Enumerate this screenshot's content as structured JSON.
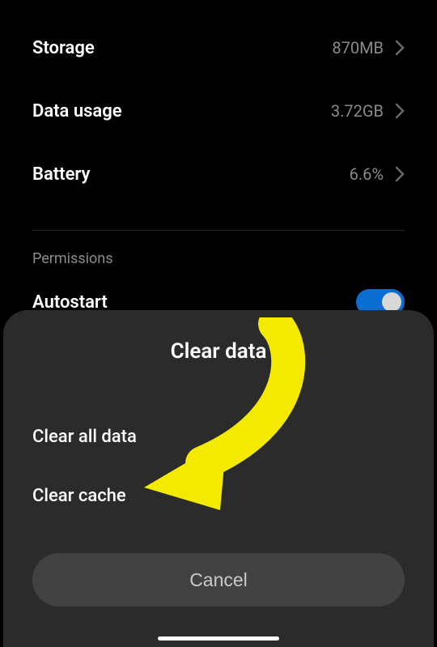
{
  "settings": {
    "rows": [
      {
        "label": "Storage",
        "value": "870MB"
      },
      {
        "label": "Data usage",
        "value": "3.72GB"
      },
      {
        "label": "Battery",
        "value": "6.6%"
      }
    ],
    "sectionHeader": "Permissions",
    "autostart": {
      "label": "Autostart",
      "enabled": true
    }
  },
  "sheet": {
    "title": "Clear data",
    "options": [
      {
        "label": "Clear all data"
      },
      {
        "label": "Clear cache"
      }
    ],
    "cancel": "Cancel"
  }
}
